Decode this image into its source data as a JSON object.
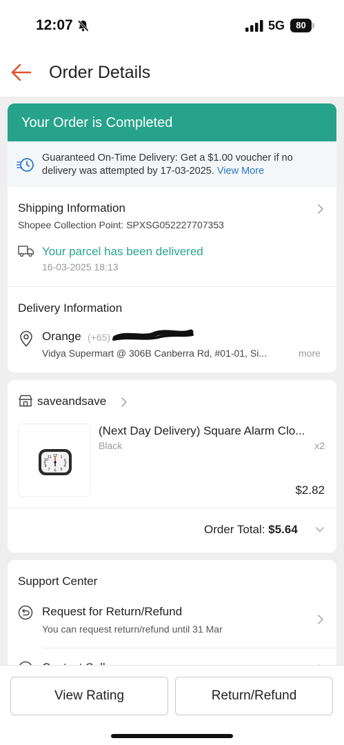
{
  "status_bar": {
    "time": "12:07",
    "network": "5G",
    "battery": "80"
  },
  "header": {
    "title": "Order Details"
  },
  "order_status": {
    "banner": "Your Order is Completed",
    "guarantee_text": "Guaranteed On-Time Delivery: Get a $1.00 voucher if no delivery was attempted by 17-03-2025.",
    "guarantee_link": "View More"
  },
  "shipping": {
    "title": "Shipping Information",
    "collection_point": "Shopee Collection Point: SPXSG052227707353",
    "status": "Your parcel has been delivered",
    "status_time": "16-03-2025 18:13"
  },
  "delivery": {
    "title": "Delivery Information",
    "name": "Orange",
    "phone": "(+65)",
    "address": "Vidya Supermart @ 306B Canberra Rd, #01-01, Si...",
    "more": "more"
  },
  "shop": {
    "name": "saveandsave",
    "product": {
      "title": "(Next Day Delivery)   Square Alarm Clo...",
      "variant": "Black",
      "qty": "x2",
      "price": "$2.82"
    },
    "order_total_label": "Order Total:",
    "order_total_value": "$5.64"
  },
  "support": {
    "title": "Support Center",
    "refund_title": "Request for Return/Refund",
    "refund_sub": "You can request return/refund until 31 Mar",
    "contact_title": "Contact Seller"
  },
  "actions": {
    "view_rating": "View Rating",
    "return_refund": "Return/Refund"
  },
  "colors": {
    "accent": "#26a38a",
    "back_arrow": "#e0522d",
    "link": "#2a78c9"
  }
}
